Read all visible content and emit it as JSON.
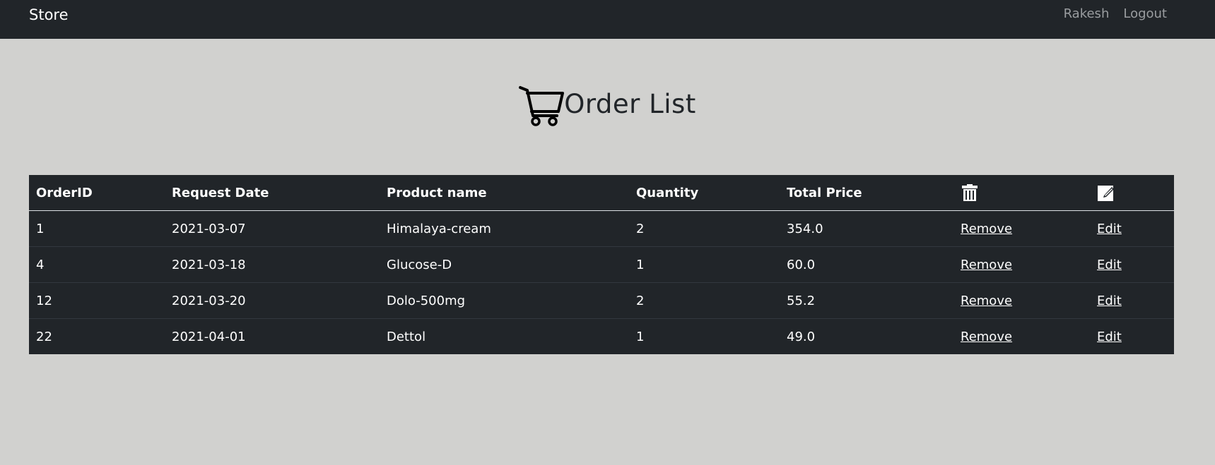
{
  "navbar": {
    "brand": "Store",
    "user": "Rakesh",
    "logout": "Logout"
  },
  "page": {
    "title": "Order List",
    "icon": "shopping-cart-icon"
  },
  "table": {
    "headers": {
      "order_id": "OrderID",
      "request_date": "Request Date",
      "product_name": "Product name",
      "quantity": "Quantity",
      "total_price": "Total Price",
      "remove_icon": "trash-icon",
      "edit_icon": "edit-icon"
    },
    "rows": [
      {
        "order_id": "1",
        "request_date": "2021-03-07",
        "product_name": "Himalaya-cream",
        "quantity": "2",
        "total_price": "354.0",
        "remove": "Remove",
        "edit": "Edit"
      },
      {
        "order_id": "4",
        "request_date": "2021-03-18",
        "product_name": "Glucose-D",
        "quantity": "1",
        "total_price": "60.0",
        "remove": "Remove",
        "edit": "Edit"
      },
      {
        "order_id": "12",
        "request_date": "2021-03-20",
        "product_name": "Dolo-500mg",
        "quantity": "2",
        "total_price": "55.2",
        "remove": "Remove",
        "edit": "Edit"
      },
      {
        "order_id": "22",
        "request_date": "2021-04-01",
        "product_name": "Dettol",
        "quantity": "1",
        "total_price": "49.0",
        "remove": "Remove",
        "edit": "Edit"
      }
    ]
  },
  "colors": {
    "background": "#d1d1cf",
    "navbar": "#212529",
    "table": "#212529",
    "text_light": "#ffffff",
    "nav_link": "#9a9da0"
  }
}
